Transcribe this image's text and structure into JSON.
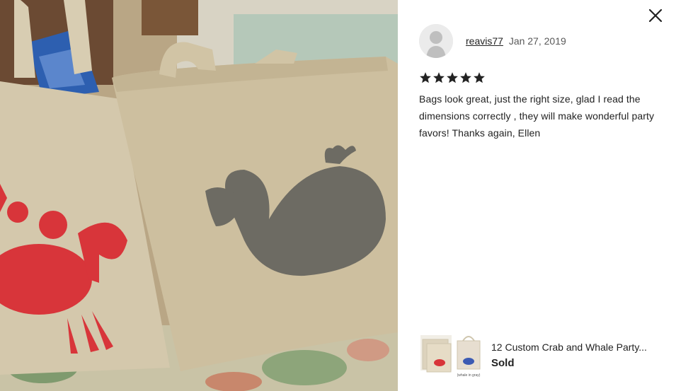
{
  "review": {
    "reviewer_name": "reavis77",
    "date": "Jan 27, 2019",
    "rating": 5,
    "text": "Bags look great, just the right size, glad I read the dimensions correctly , they will make wonderful party favors! Thanks again, Ellen"
  },
  "listing": {
    "title": "12 Custom Crab and Whale Party...",
    "status": "Sold",
    "thumb_caption": "(whale in gray)"
  },
  "icons": {
    "close": "close-icon",
    "avatar": "user-avatar-icon",
    "star": "star-icon"
  },
  "colors": {
    "star": "#222222",
    "crab": "#d8353a",
    "whale": "#6d6b63",
    "canvas_bag": "#cdbf9f"
  }
}
